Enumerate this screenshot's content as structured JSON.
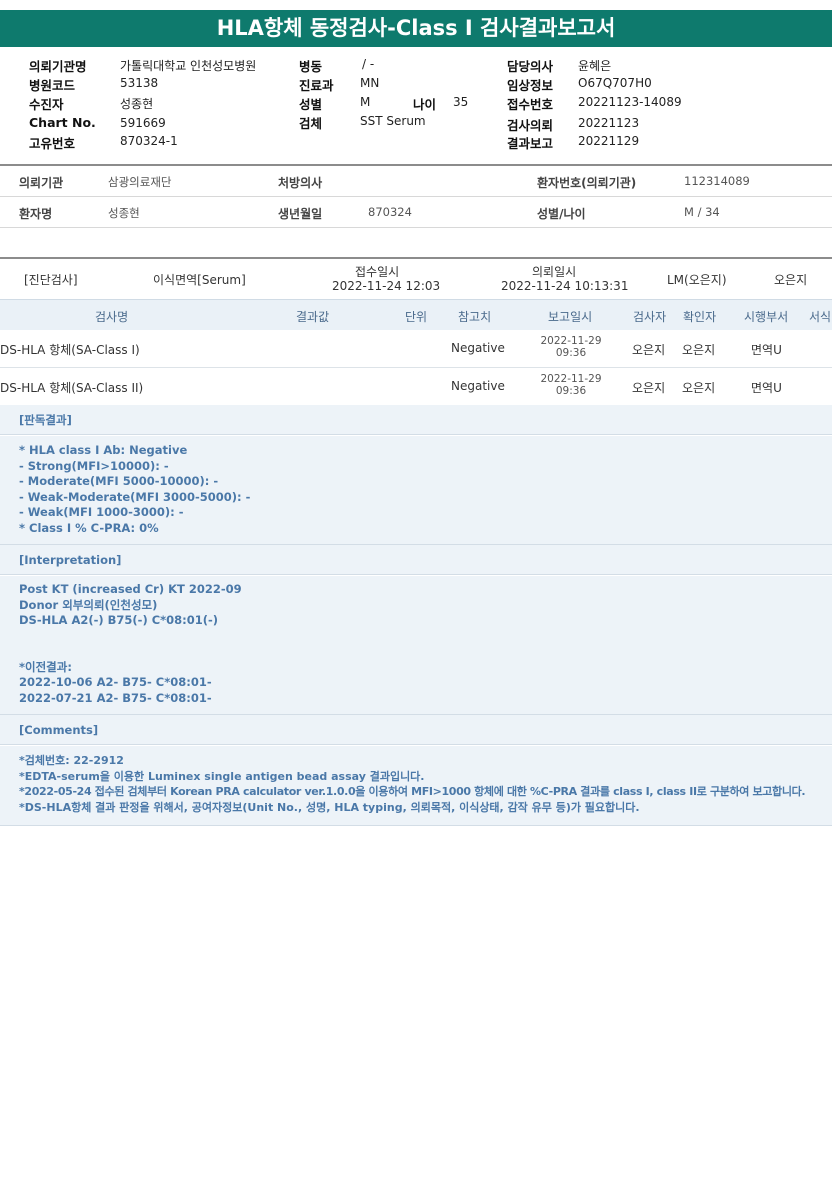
{
  "title": "HLA항체 동정검사-Class I 검사결과보고서",
  "header": {
    "col1": [
      {
        "label": "의뢰기관명",
        "value": "가톨릭대학교 인천성모병원"
      },
      {
        "label": "병원코드",
        "value": "53138"
      },
      {
        "label": "수진자",
        "value": "성종현"
      },
      {
        "label": "Chart No.",
        "value": "591669"
      },
      {
        "label": "고유번호",
        "value": "870324-1"
      }
    ],
    "col2": [
      {
        "label": "병동",
        "value": "/ -"
      },
      {
        "label": "진료과",
        "value": "MN"
      },
      {
        "label": "성별",
        "value": "M"
      },
      {
        "label": "검체",
        "value": "SST Serum"
      }
    ],
    "age_label": "나이",
    "age_value": "35",
    "col3": [
      {
        "label": "담당의사",
        "value": "윤혜은"
      },
      {
        "label": "임상정보",
        "value": "O67Q707H0"
      },
      {
        "label": "접수번호",
        "value": "20221123-14089"
      },
      {
        "label": "검사의뢰",
        "value": "20221123"
      },
      {
        "label": "결과보고",
        "value": "20221129"
      }
    ]
  },
  "patient": {
    "row1": {
      "org_label": "의뢰기관",
      "org_value": "삼광의료재단",
      "doctor_label": "처방의사",
      "doctor_value": "",
      "pid_label": "환자번호(의뢰기관)",
      "pid_value": "112314089"
    },
    "row2": {
      "name_label": "환자명",
      "name_value": "성종현",
      "dob_label": "생년월일",
      "dob_value": "870324",
      "sexage_label": "성별/나이",
      "sexage_value": "M / 34"
    }
  },
  "diagnosis": {
    "label": "[진단검사]",
    "dept": "이식면역[Serum]",
    "received_label": "접수일시",
    "received_value": "2022-11-24  12:03",
    "requested_label": "의뢰일시",
    "requested_value": "2022-11-24  10:13:31",
    "lm": "LM(오은지)",
    "tech": "오은지"
  },
  "table": {
    "headers": {
      "name": "검사명",
      "result": "결과값",
      "unit": "단위",
      "ref": "참고치",
      "report": "보고일시",
      "tester": "검사자",
      "checker": "확인자",
      "dept": "시행부서",
      "form": "서식"
    },
    "rows": [
      {
        "name": "DS-HLA 항체(SA-Class I)",
        "result": "",
        "unit": "",
        "ref": "Negative",
        "report_date": "2022-11-29",
        "report_time": "09:36",
        "tester": "오은지",
        "checker": "오은지",
        "dept": "면역U"
      },
      {
        "name": "DS-HLA 항체(SA-Class II)",
        "result": "",
        "unit": "",
        "ref": "Negative",
        "report_date": "2022-11-29",
        "report_time": "09:36",
        "tester": "오은지",
        "checker": "오은지",
        "dept": "면역U"
      }
    ]
  },
  "sections": {
    "judgement": {
      "title": "[판독결과]",
      "lines": [
        "* HLA class I Ab: Negative",
        "- Strong(MFI>10000): -",
        "- Moderate(MFI 5000-10000): -",
        "- Weak-Moderate(MFI 3000-5000): -",
        "- Weak(MFI 1000-3000): -",
        "* Class I % C-PRA: 0%"
      ]
    },
    "interpretation": {
      "title": "[Interpretation]",
      "lines_a": [
        "Post KT (increased Cr) KT 2022-09",
        "Donor 외부의뢰(인천성모)",
        "DS-HLA A2(-) B75(-) C*08:01(-)"
      ],
      "lines_b": [
        "*이전결과:",
        "2022-10-06 A2- B75- C*08:01-",
        "2022-07-21 A2- B75- C*08:01-"
      ]
    },
    "comments": {
      "title": "[Comments]",
      "lines": [
        "*검체번호: 22-2912",
        "*EDTA-serum을 이용한 Luminex single antigen bead assay 결과입니다.",
        "*2022-05-24 접수된 검체부터 Korean PRA calculator ver.1.0.0을 이용하여 MFI>1000 항체에 대한 %C-PRA 결과를 class I, class II로 구분하여 보고합니다.",
        "*DS-HLA항체 결과 판정을 위해서, 공여자정보(Unit No., 성명, HLA typing, 의뢰목적, 이식상태, 감작 유무 등)가 필요합니다."
      ]
    }
  }
}
